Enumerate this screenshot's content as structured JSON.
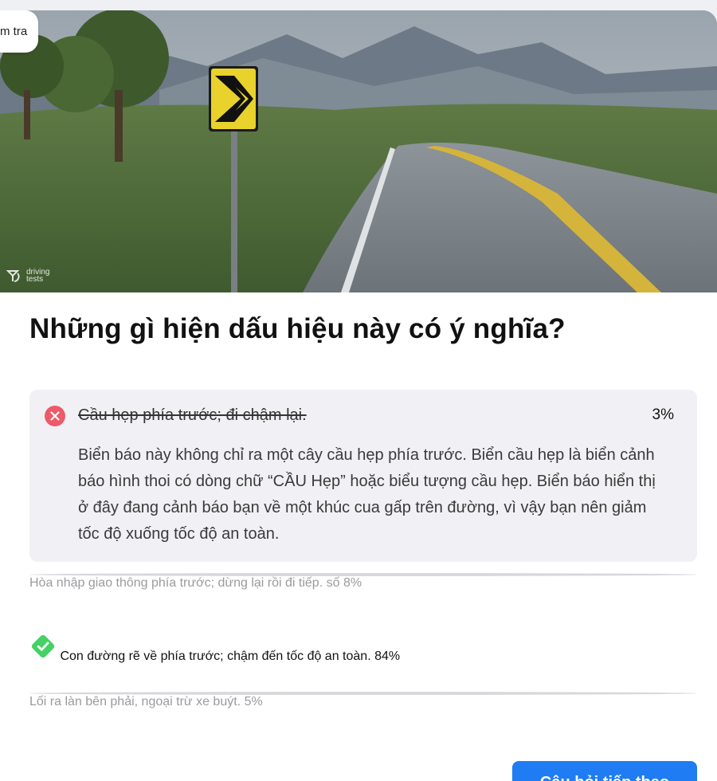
{
  "header": {
    "tab_label": "m tra",
    "watermark_line1": "driving",
    "watermark_line2": "tests"
  },
  "question": {
    "text": "Những gì hiện dấu hiệu này có ý nghĩa?"
  },
  "answers": [
    {
      "label": "Cầu hẹp phía trước; đi chậm lại.",
      "percent": "3%",
      "state": "selected-wrong",
      "explanation": "Biển báo này không chỉ ra một cây cầu hẹp phía trước. Biển cầu hẹp là biển cảnh báo hình thoi có dòng chữ “CẦU Hẹp” hoặc biểu tượng cầu hẹp. Biển báo hiển thị ở đây đang cảnh báo bạn về một khúc cua gấp trên đường, vì vậy bạn nên giảm tốc độ xuống tốc độ an toàn."
    },
    {
      "label": "Hòa nhập giao thông phía trước; dừng lại rồi đi tiếp.",
      "percent": "số 8%",
      "state": "unselected"
    },
    {
      "label": "Con đường rẽ về phía trước; chậm đến tốc độ an toàn.",
      "percent": "84%",
      "state": "correct"
    },
    {
      "label": "Lối ra làn bên phải, ngoại trừ xe buýt.",
      "percent": "5%",
      "state": "unselected"
    }
  ],
  "footer": {
    "next_button_label": "Câu hỏi tiếp theo"
  },
  "icons": {
    "wrong": "x-circle-icon",
    "correct": "check-diamond-icon",
    "unselected": "radio-circle-icon"
  },
  "colors": {
    "wrong_red": "#ee5a6a",
    "correct_green": "#45d164",
    "button_blue": "#1f7cf2",
    "sign_yellow": "#e8d22b"
  }
}
